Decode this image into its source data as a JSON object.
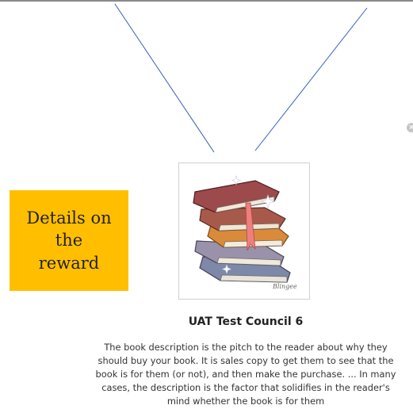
{
  "callout": {
    "text": "Details on the reward"
  },
  "reward": {
    "image_icon": "stack-of-books-icon",
    "image_signature": "Blingee",
    "title": "UAT Test Council 6",
    "description": "The book description is the pitch to the reader about why they should buy your book. It is sales copy to get them to see that the book is for them (or not), and then make the purchase. ... In many cases, the description is the factor that solidifies in the reader's mind whether the book is for them"
  },
  "colors": {
    "callout_background": "#ffbf00",
    "connector_line": "#2f5fbf",
    "top_border": "#8a8a8a"
  }
}
